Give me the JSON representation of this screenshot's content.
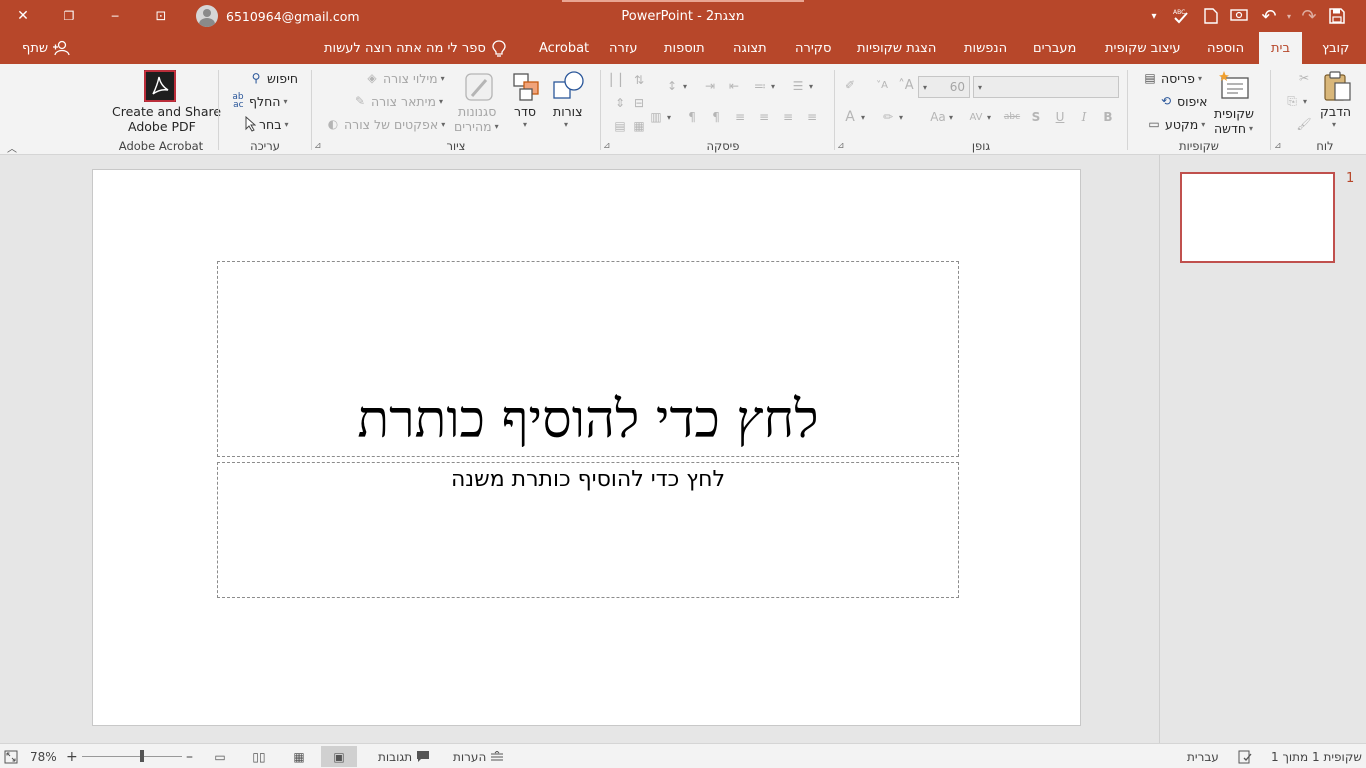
{
  "titlebar": {
    "title": "PowerPoint  -  מצגת2",
    "account": "6510964@gmail.com",
    "close_icon": "✕",
    "restore_icon": "❐",
    "minimize_icon": "─",
    "ribbon_display_icon": "⊡"
  },
  "qat": {
    "save_icon": "💾",
    "undo_icon": "↶",
    "redo_icon": "↷",
    "customize_icon": "▾"
  },
  "tabs": {
    "file": "קובץ",
    "home": "בית",
    "insert": "הוספה",
    "design": "עיצוב שקופית",
    "transitions": "מעברים",
    "animations": "הנפשות",
    "slideshow": "הצגת שקופיות",
    "review": "סקירה",
    "view": "תצוגה",
    "addins": "תוספות",
    "help": "עזרה",
    "acrobat": "Acrobat",
    "tellme": "ספר לי מה אתה רוצה לעשות",
    "share": "שתף"
  },
  "ribbon": {
    "clipboard": {
      "label": "לוח",
      "paste": "הדבק"
    },
    "slides": {
      "label": "שקופיות",
      "new_slide_1": "שקופית",
      "new_slide_2": "חדשה",
      "layout": "פריסה",
      "reset": "איפוס",
      "section": "מקטע"
    },
    "font": {
      "label": "גופן",
      "size": "60"
    },
    "paragraph": {
      "label": "פיסקה"
    },
    "drawing": {
      "label": "ציור",
      "shapes": "צורות",
      "arrange": "סדר",
      "quick_styles_1": "סגנונות",
      "quick_styles_2": "מהירים",
      "shape_fill": "מילוי צורה",
      "shape_outline": "מיתאר צורה",
      "shape_effects": "אפקטים של צורה"
    },
    "editing": {
      "label": "עריכה",
      "find": "חיפוש",
      "replace": "החלף",
      "select": "בחר"
    },
    "acrobat": {
      "label": "Adobe Acrobat",
      "create_1": "Create and Share",
      "create_2": "Adobe PDF"
    }
  },
  "slide": {
    "title_placeholder": "לחץ כדי להוסיף כותרת",
    "subtitle_placeholder": "לחץ כדי להוסיף כותרת משנה"
  },
  "thumbnail": {
    "number": "1"
  },
  "statusbar": {
    "slide_info": "שקופית 1 מתוך 1",
    "language": "עברית",
    "notes": "הערות",
    "comments": "תגובות",
    "zoom": "78%",
    "zoom_minus": "–",
    "zoom_plus": "+"
  }
}
